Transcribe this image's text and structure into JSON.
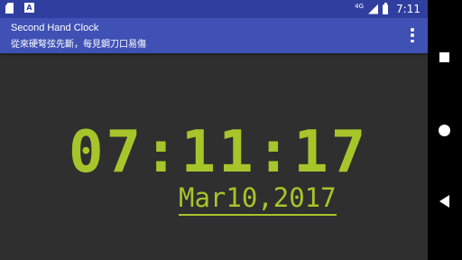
{
  "status_bar": {
    "network": "4G",
    "time": "7:11"
  },
  "toolbar": {
    "title": "Second Hand Clock",
    "subtitle": "從來硬弩弦先斷，每見鋼刀口易傷"
  },
  "clock": {
    "time": "07:11:17",
    "date": "Mar10,2017",
    "color": "#a6c52a"
  },
  "colors": {
    "status_bar": "#303f9f",
    "toolbar": "#3f51b5",
    "background": "#2f2f2f"
  },
  "icons": [
    "sd-card-icon",
    "a-notification-icon",
    "signal-icon",
    "battery-icon",
    "overflow-menu-icon",
    "recents-icon",
    "home-icon",
    "back-icon"
  ]
}
